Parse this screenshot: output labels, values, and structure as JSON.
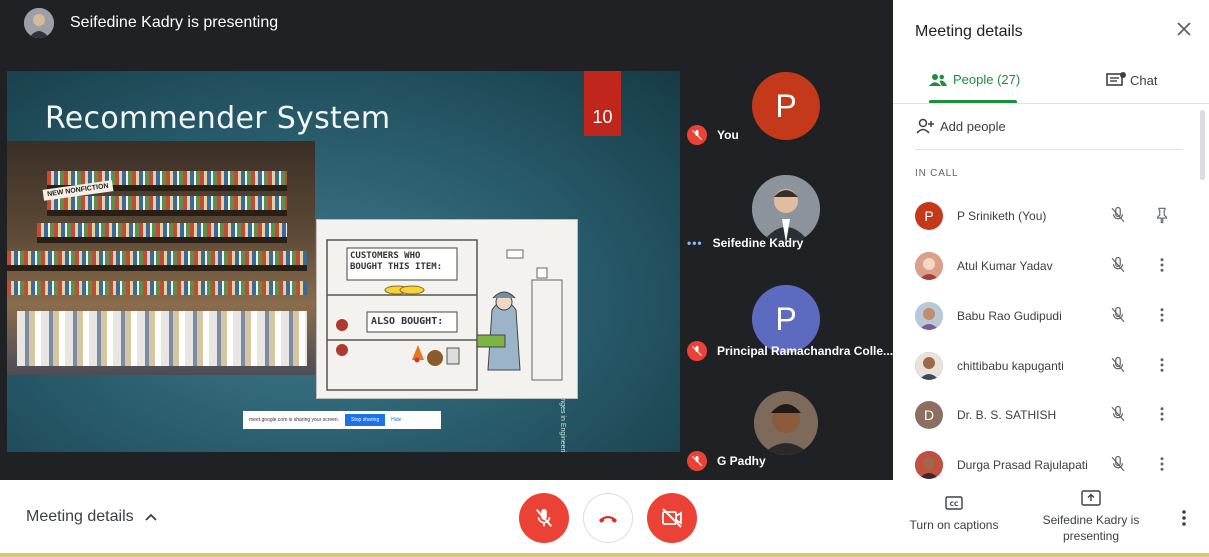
{
  "presenter_bar": {
    "title": "Seifedine Kadry is presenting"
  },
  "slide": {
    "title": "Recommender System",
    "number": "10",
    "side_text": "International Conference on Recent Challenges in Engineering Science and Technology-2021",
    "cartoon_sign_top": "CUSTOMERS WHO BOUGHT THIS ITEM:",
    "cartoon_sign_bottom": "ALSO BOUGHT:",
    "store_sign": "NEW NONFICTION"
  },
  "share_bar": {
    "message": "meet.google.com is sharing your screen.",
    "stop_label": "Stop sharing",
    "hide_label": "Hide"
  },
  "tiles": [
    {
      "name": "You",
      "initial": "P",
      "color": "#c5391b",
      "muted": true
    },
    {
      "name": "Seifedine Kadry",
      "initial": "",
      "color": "#6b7078",
      "muted": false
    },
    {
      "name": "Principal Ramachandra Colle...",
      "initial": "P",
      "color": "#5c6bc0",
      "muted": true
    },
    {
      "name": "G Padhy",
      "initial": "",
      "color": "#6d4c3d",
      "muted": true
    }
  ],
  "bottom": {
    "meeting_details": "Meeting details",
    "captions_label": "Turn on captions",
    "presenting_label": "Seifedine Kadry is presenting"
  },
  "panel": {
    "title": "Meeting details",
    "tab_people": "People (27)",
    "tab_chat": "Chat",
    "add_people": "Add people",
    "in_call": "IN CALL",
    "people": [
      {
        "name": "P Sriniketh (You)",
        "initial": "P",
        "color": "#c5391b"
      },
      {
        "name": "Atul Kumar Yadav",
        "initial": "",
        "color": "#c98a7a"
      },
      {
        "name": "Babu Rao Gudipudi",
        "initial": "",
        "color": "#9ab0c4"
      },
      {
        "name": "chittibabu kapuganti",
        "initial": "",
        "color": "#8d6e5c"
      },
      {
        "name": "Dr. B. S. SATHISH",
        "initial": "D",
        "color": "#8d6e63"
      },
      {
        "name": "Durga Prasad Rajulapati",
        "initial": "",
        "color": "#b5463a"
      }
    ]
  },
  "colors": {
    "accent_green": "#1e8e3e",
    "mute_red": "#ea4335",
    "stage": "#202124"
  }
}
